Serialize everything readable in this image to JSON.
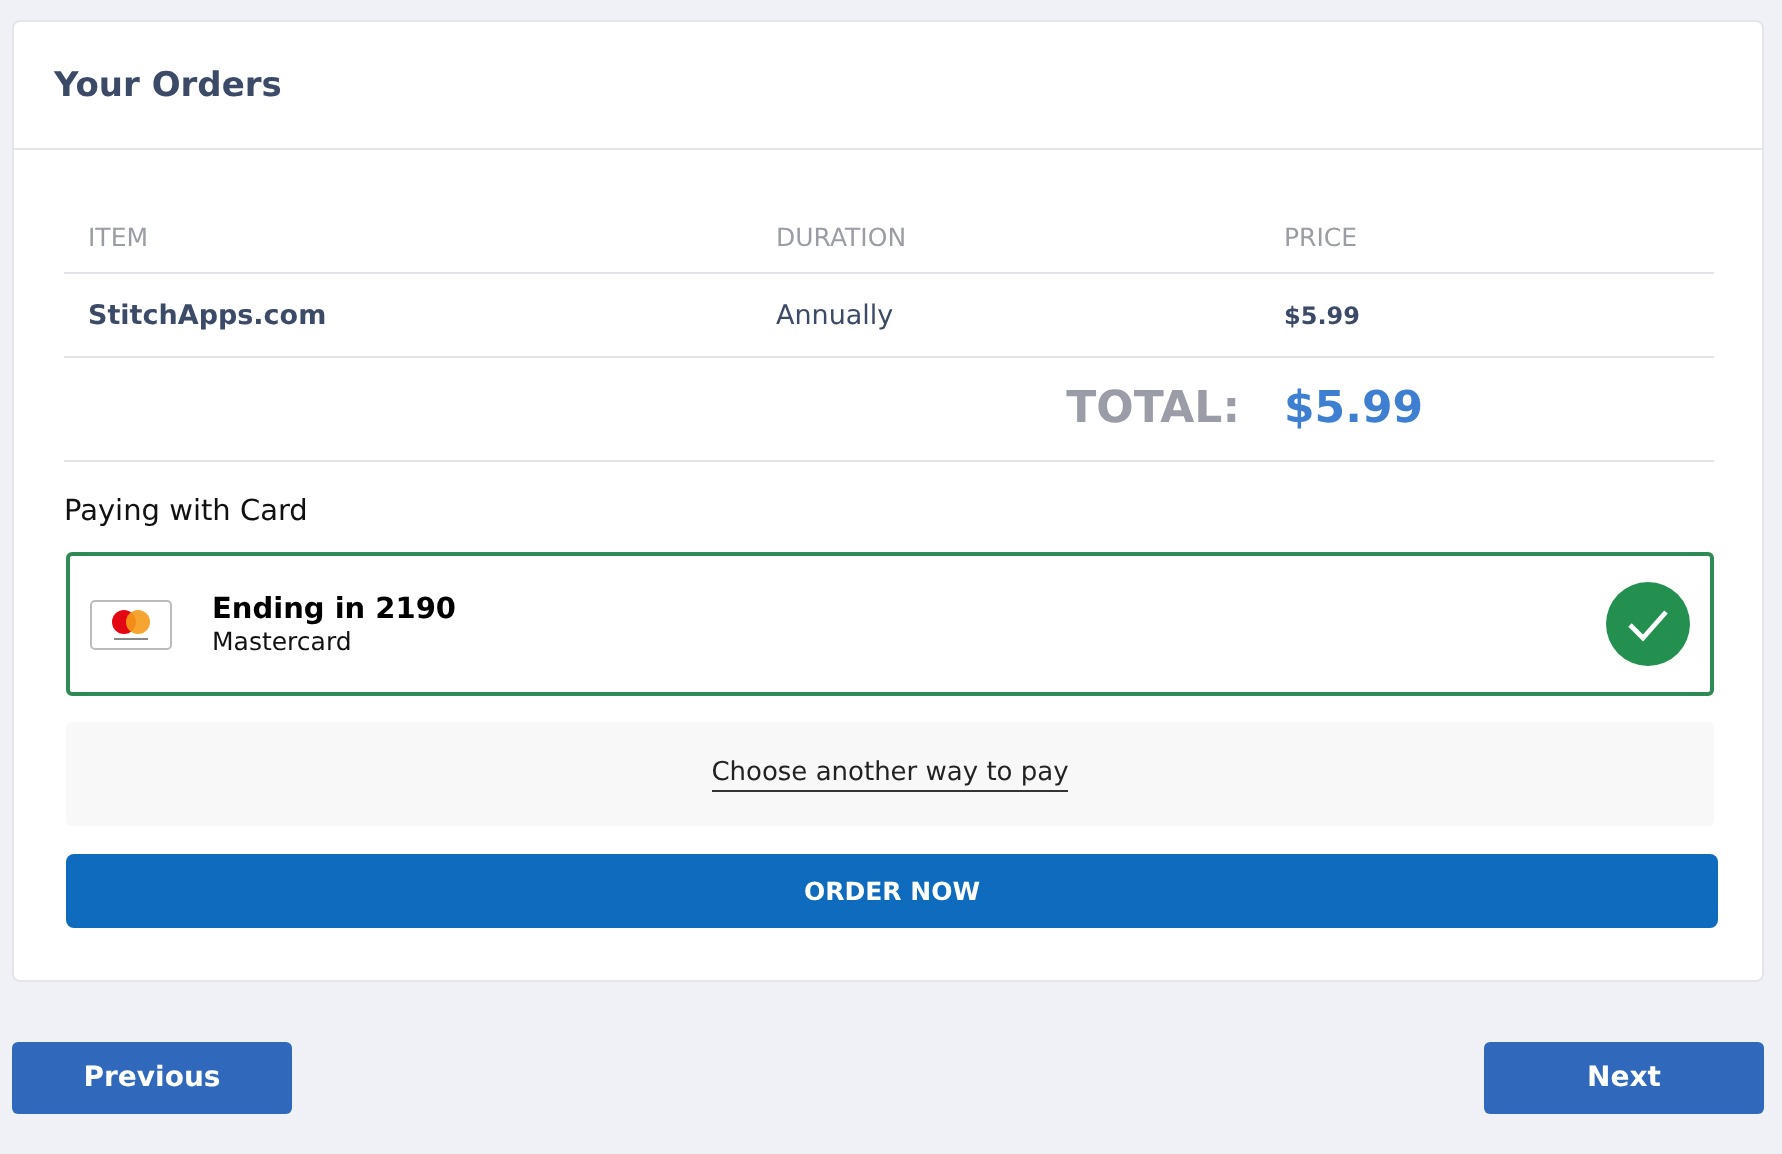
{
  "panel": {
    "title": "Your Orders"
  },
  "table": {
    "columns": [
      "ITEM",
      "DURATION",
      "PRICE"
    ],
    "rows": [
      {
        "item": "StitchApps.com",
        "duration": "Annually",
        "price": "$5.99"
      }
    ],
    "total_label": "TOTAL:",
    "total_value": "$5.99"
  },
  "payment": {
    "label": "Paying with Card",
    "cards": [
      {
        "title": "Ending in 2190",
        "brand": "Mastercard",
        "selected": true
      }
    ],
    "other_link": "Choose another way to pay"
  },
  "order_button": "ORDER NOW",
  "footer": {
    "previous": "Previous",
    "next": "Next"
  }
}
